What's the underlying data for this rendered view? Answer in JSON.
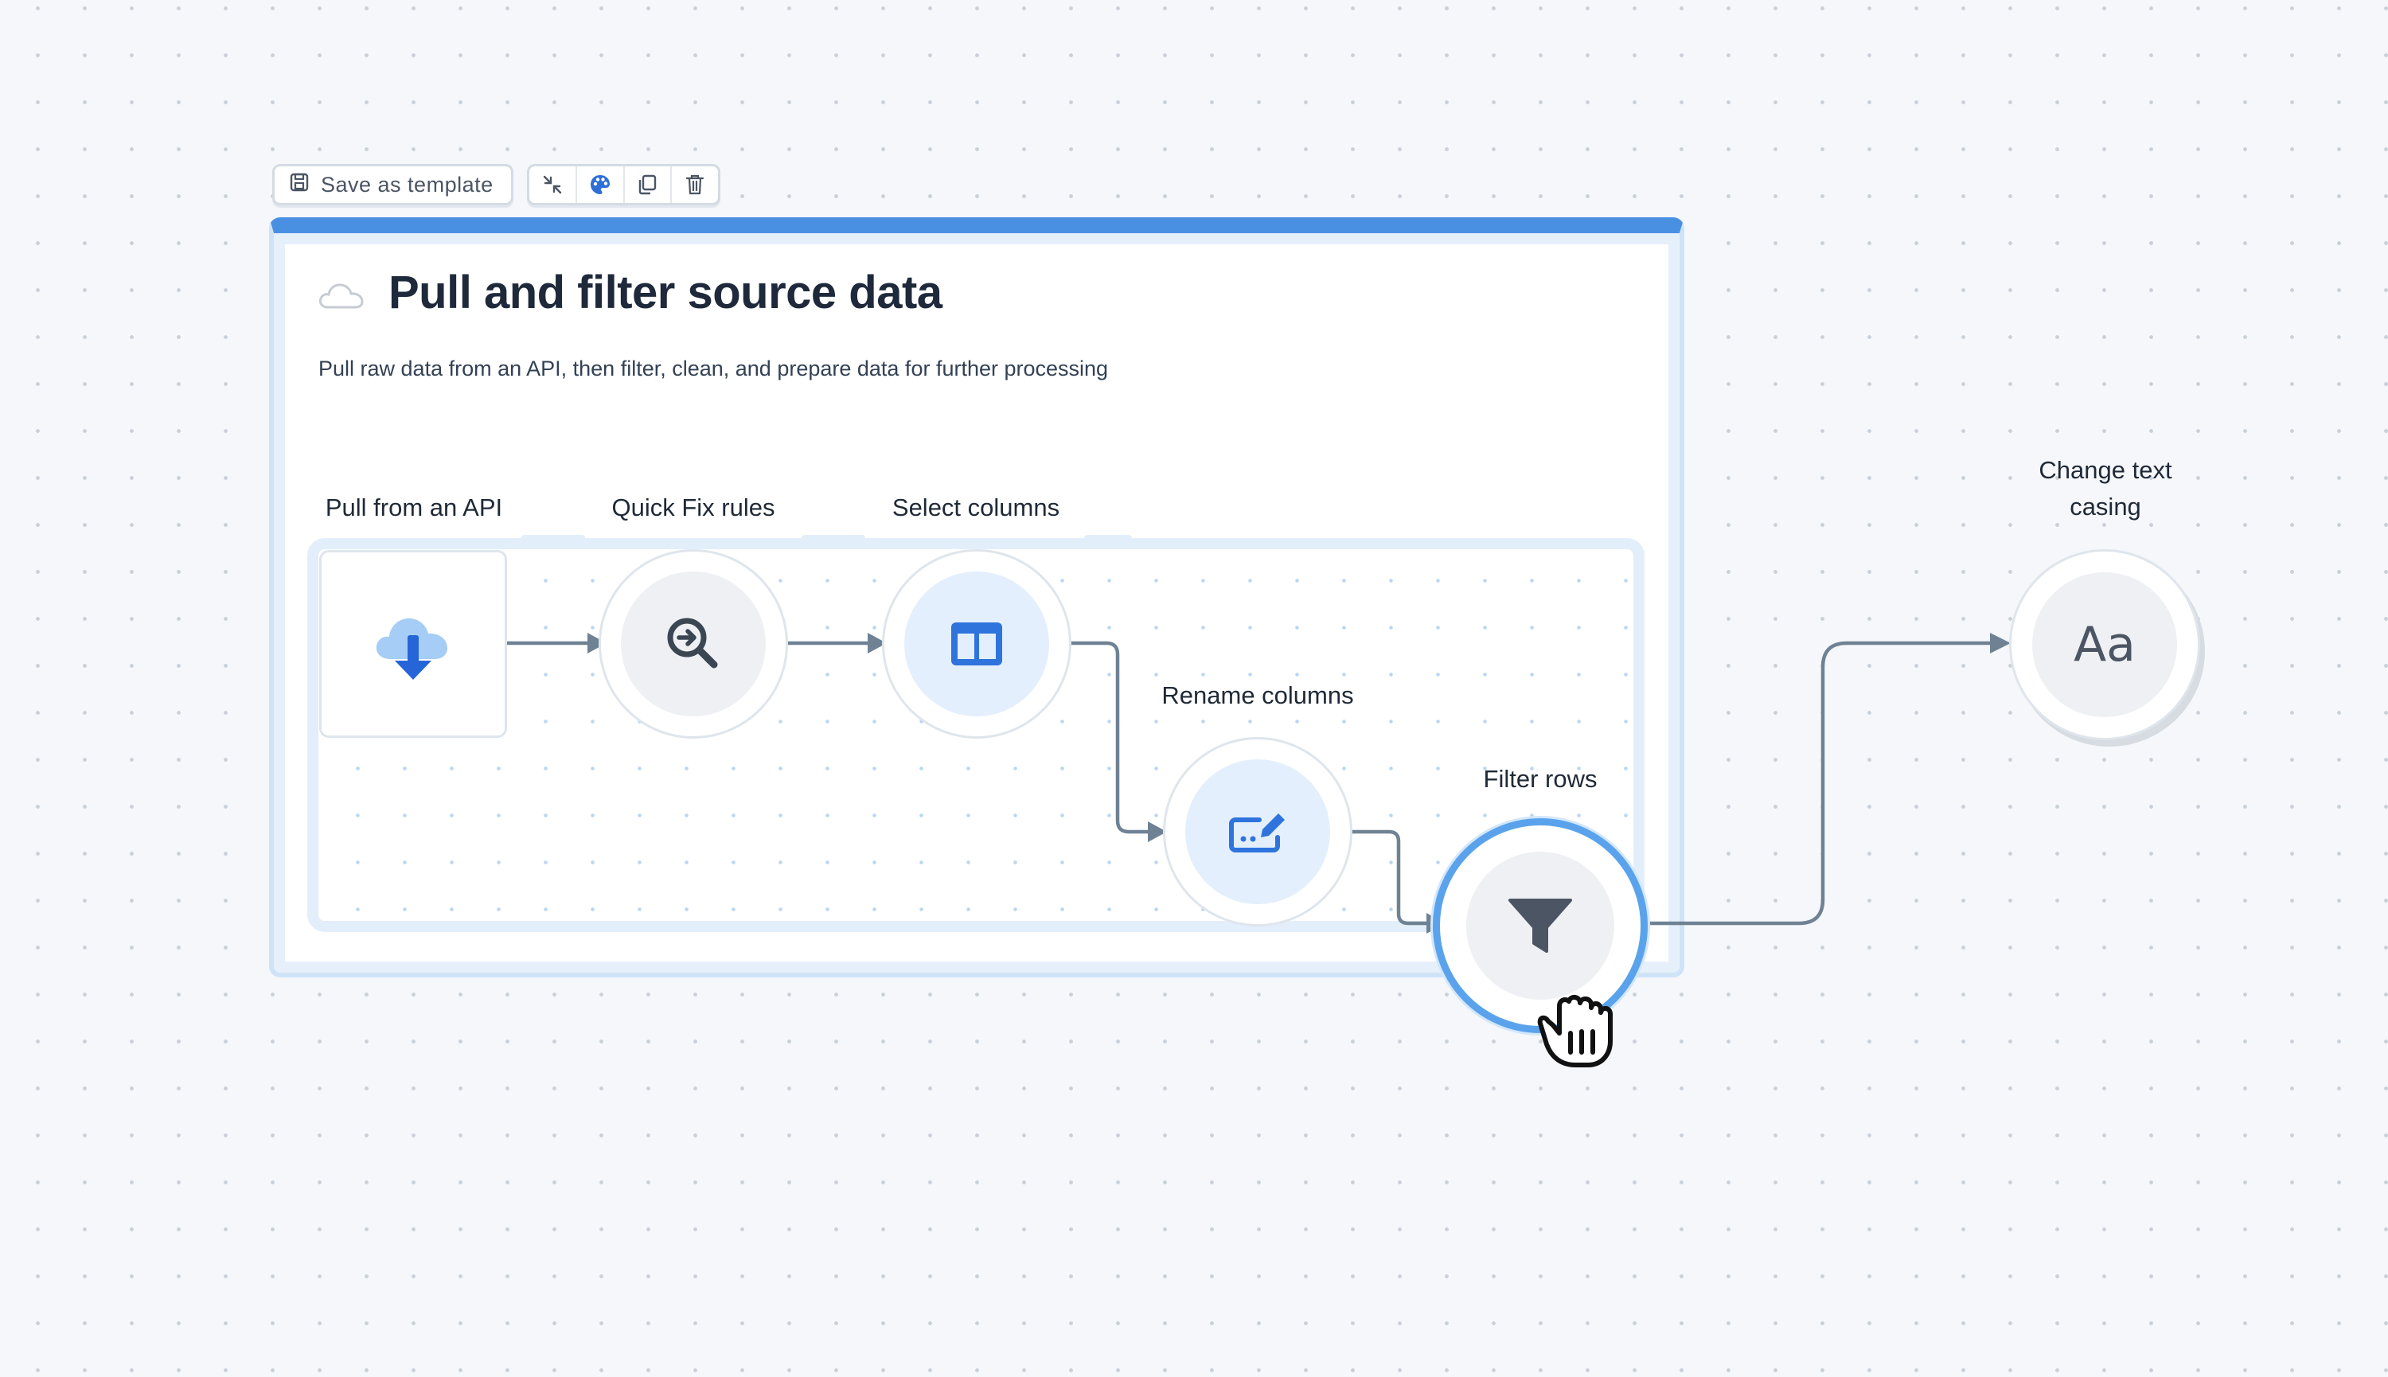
{
  "toolbar": {
    "save_template_label": "Save as template",
    "icons": [
      "collapse-icon",
      "palette-icon",
      "duplicate-icon",
      "trash-icon"
    ]
  },
  "group": {
    "icon": "cloud-icon",
    "title": "Pull and filter source data",
    "description": "Pull raw data from an API, then filter, clean, and prepare data for further processing"
  },
  "nodes": {
    "pull_api": {
      "label": "Pull from an API",
      "icon": "cloud-download-icon"
    },
    "quick_fix": {
      "label": "Quick Fix rules",
      "icon": "magnify-arrow-icon"
    },
    "select_columns": {
      "label": "Select columns",
      "icon": "columns-icon"
    },
    "rename_columns": {
      "label": "Rename columns",
      "icon": "edit-field-icon"
    },
    "filter_rows": {
      "label": "Filter rows",
      "icon": "funnel-icon"
    },
    "change_casing": {
      "label": "Change text casing",
      "icon_text": "Aa"
    }
  },
  "colors": {
    "accent": "#4a90e2",
    "selected_ring": "#5aa3ec",
    "edge": "#6f8294",
    "node_fill_gray": "#eef0f3",
    "node_fill_blue": "#e3effc"
  }
}
